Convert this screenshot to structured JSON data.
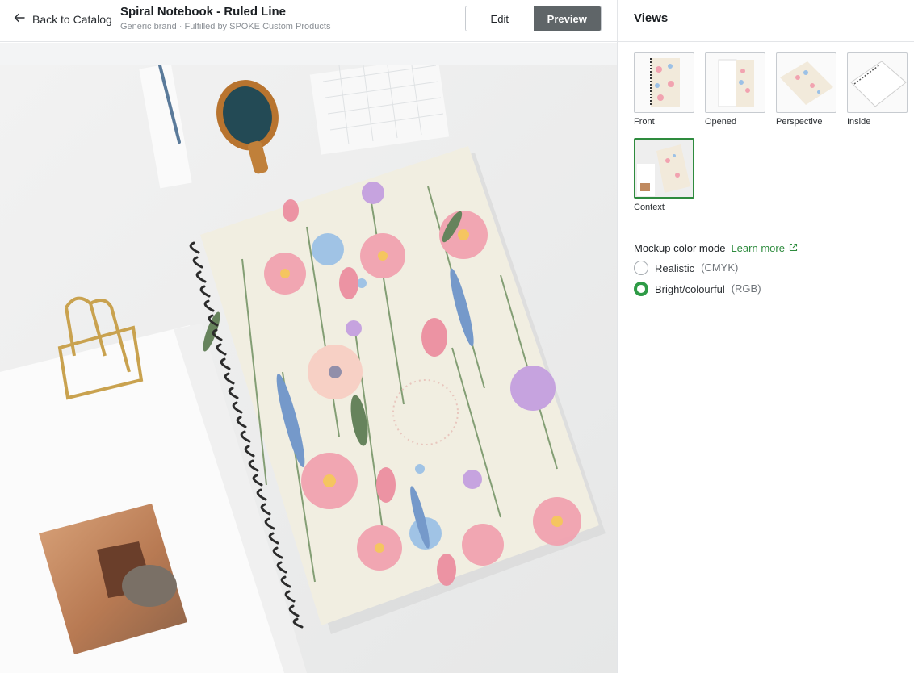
{
  "header": {
    "back_label": "Back to Catalog",
    "title": "Spiral Notebook - Ruled Line",
    "subtitle": "Generic brand · Fulfilled by SPOKE Custom Products",
    "edit_label": "Edit",
    "preview_label": "Preview"
  },
  "panel": {
    "views_title": "Views",
    "views": [
      {
        "label": "Front"
      },
      {
        "label": "Opened"
      },
      {
        "label": "Perspective"
      },
      {
        "label": "Inside"
      },
      {
        "label": "Context"
      }
    ],
    "active_view": "Context",
    "color_mode": {
      "title": "Mockup color mode",
      "learn_more": "Learn more",
      "options": [
        {
          "label": "Realistic",
          "code": "(CMYK)",
          "checked": false
        },
        {
          "label": "Bright/colourful",
          "code": "(RGB)",
          "checked": true
        }
      ]
    }
  },
  "colors": {
    "accent": "#2e8b3e",
    "preview_button": "#5f6568"
  }
}
